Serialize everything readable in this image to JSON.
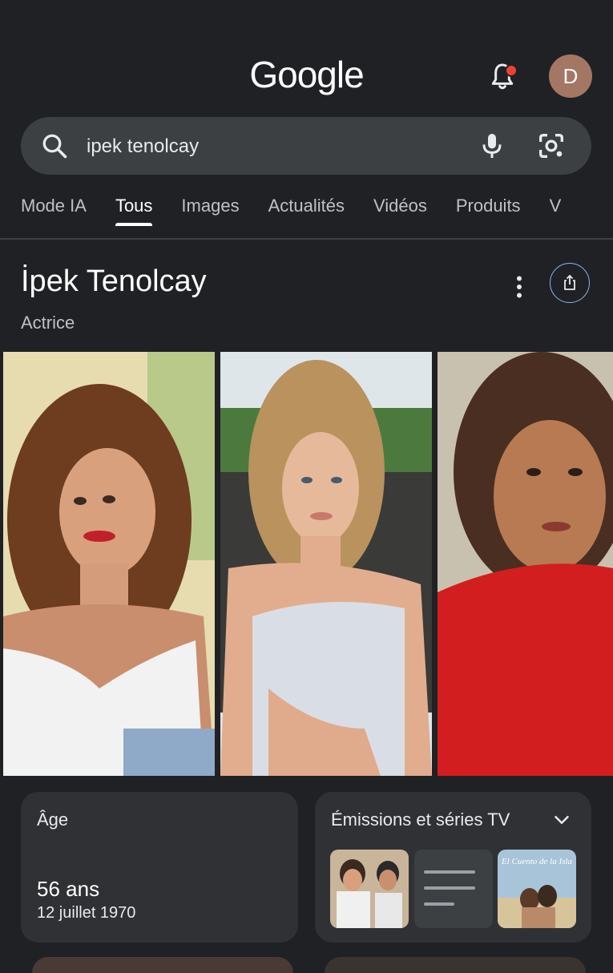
{
  "header": {
    "logo": "Google",
    "avatar_letter": "D",
    "bell_icon": "notifications-bell-icon"
  },
  "search": {
    "query": "ipek tenolcay",
    "icons": [
      "search-icon",
      "mic-icon",
      "lens-camera-icon"
    ]
  },
  "tabs": [
    {
      "label": "Mode IA",
      "active": false
    },
    {
      "label": "Tous",
      "active": true
    },
    {
      "label": "Images",
      "active": false
    },
    {
      "label": "Actualités",
      "active": false
    },
    {
      "label": "Vidéos",
      "active": false
    },
    {
      "label": "Produits",
      "active": false
    },
    {
      "label": "V",
      "active": false
    }
  ],
  "entity": {
    "title": "İpek Tenolcay",
    "subtitle": "Actrice",
    "photos": [
      "curly-hair-white-top-photo",
      "blonde-updo-white-dress-photo",
      "red-turtleneck-photo"
    ]
  },
  "age_card": {
    "label": "Âge",
    "value": "56 ans",
    "birthdate": "12 juillet 1970"
  },
  "shows_card": {
    "label": "Émissions et séries TV",
    "thumbnails": [
      "series-thumbnail-1",
      "series-thumbnail-placeholder",
      "el-cuento-de-la-isla-thumbnail"
    ],
    "thumbnail_text": "El Cuento de la Isla"
  },
  "colors": {
    "background": "#202124",
    "surface": "#303134",
    "search_bg": "#3c4043",
    "accent_blue": "#8ab4f8",
    "notification_red": "#ea4335"
  }
}
